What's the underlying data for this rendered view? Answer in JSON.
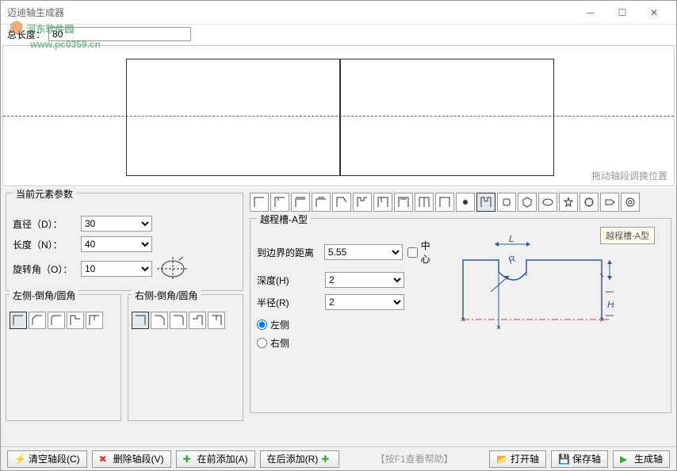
{
  "titlebar": {
    "title": "迈迪轴生成器"
  },
  "watermark": {
    "site": "河东软件园",
    "url": "www.pc0359.cn"
  },
  "topbar": {
    "length_label": "总长度：",
    "length_value": "80"
  },
  "canvas": {
    "hint": "拖动轴段调换位置"
  },
  "params": {
    "title": "当前元素参数",
    "diameter_label": "直径（D）：",
    "diameter_value": "30",
    "length_label": "长度（N）：",
    "length_value": "40",
    "rotate_label": "旋转角（O）：",
    "rotate_value": "10"
  },
  "chamfer": {
    "left_title": "左侧-倒角/圆角",
    "right_title": "右侧-倒角/圆角"
  },
  "groove": {
    "title": "越程槽-A型",
    "dist_label": "到边界的距离",
    "dist_value": "5.55",
    "center_label": "中心",
    "depth_label": "深度(H)",
    "depth_value": "2",
    "radius_label": "半径(R)",
    "radius_value": "2",
    "side_left": "左侧",
    "side_right": "右侧"
  },
  "tooltip": "越程槽-A型",
  "buttons": {
    "clear": "清空轴段(C)",
    "delete": "删除轴段(V)",
    "add_before": "在前添加(A)",
    "add_after": "在后添加(R)",
    "help_hint": "【按F1查看帮助】",
    "open": "打开轴",
    "save": "保存轴",
    "generate": "生成轴"
  }
}
